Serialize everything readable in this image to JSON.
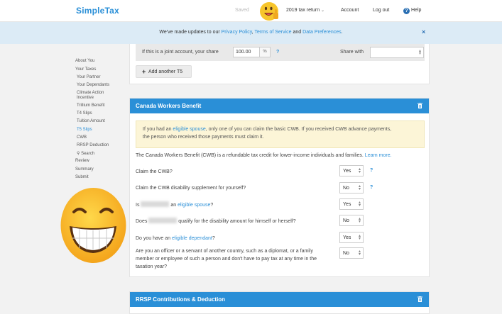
{
  "header": {
    "logo": "SimpleTax",
    "saved": "Saved",
    "tax_return": "2019 tax return",
    "account": "Account",
    "logout": "Log out",
    "help": "Help"
  },
  "notice": {
    "prefix": "We've made updates to our ",
    "privacy": "Privacy Policy",
    "comma": ", ",
    "terms": "Terms of Service",
    "and": " and ",
    "data": "Data Preferences",
    "suffix": ".",
    "close": "×"
  },
  "sidebar": {
    "items": [
      {
        "label": "About You"
      },
      {
        "label": "Your Taxes"
      },
      {
        "label": "Your Partner"
      },
      {
        "label": "Your Dependants"
      },
      {
        "label": "Climate Action"
      },
      {
        "label": "Incentive"
      },
      {
        "label": "Trillium Benefit"
      },
      {
        "label": "T4 Slips"
      },
      {
        "label": "Tuition Amount"
      },
      {
        "label": "T5 Slips"
      },
      {
        "label": "CWB"
      },
      {
        "label": "RRSP Deduction"
      },
      {
        "label": "Search"
      },
      {
        "label": "Review"
      },
      {
        "label": "Summary"
      },
      {
        "label": "Submit"
      }
    ]
  },
  "t5": {
    "joint_label": "If this is a joint account, your share",
    "share_value": "100.00",
    "pct": "%",
    "share_with": "Share with",
    "add_button": "Add another T5"
  },
  "cwb": {
    "title": "Canada Workers Benefit",
    "alert_1": "If you had an ",
    "alert_link": "eligible spouse",
    "alert_2": ", only one of you can claim the basic CWB. If you received CWB advance payments,",
    "alert_3": "the person who received those payments must claim it.",
    "para": "The Canada Workers Benefit (CWB) is a refundable tax credit for lower-income individuals and families.",
    "learn_more": "Learn more.",
    "questions": [
      {
        "text": "Claim the CWB?",
        "value": "Yes"
      },
      {
        "text": "Claim the CWB disability supplement for yourself?",
        "value": "No"
      },
      {
        "pre": "Is",
        "post": "an",
        "link": "eligible spouse",
        "end": "?",
        "value": "Yes"
      },
      {
        "pre": "Does",
        "post": "qualify for the disability amount for himself or herself?",
        "value": "No"
      },
      {
        "pre": "Do you have an ",
        "link": "eligible dependant",
        "end": "?",
        "value": "Yes"
      },
      {
        "line1": "Are you an officer or a servant of another country, such as a diplomat, or a family",
        "line2": "member or employee of such a person and don't have to pay tax at any time in the",
        "line3": "taxation year?",
        "value": "No"
      }
    ]
  },
  "rrsp": {
    "title": "RRSP Contributions & Deduction"
  },
  "colors": {
    "brand": "#2a8fd7",
    "notice_bg": "#dcebf6",
    "alert_bg": "#fcf5d7"
  }
}
